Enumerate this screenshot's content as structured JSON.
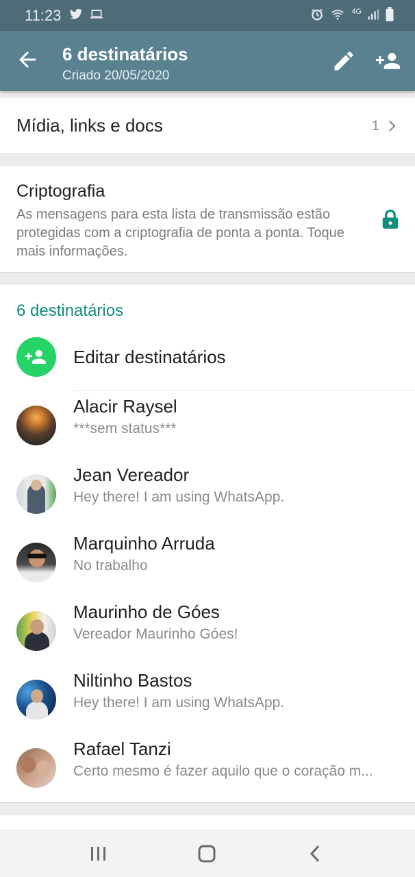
{
  "status_bar": {
    "time": "11:23",
    "network": "4G"
  },
  "header": {
    "title": "6 destinatários",
    "subtitle": "Criado 20/05/2020"
  },
  "media": {
    "label": "Mídia, links e docs",
    "count": "1"
  },
  "encryption": {
    "title": "Criptografia",
    "text": "As mensagens para esta lista de transmissão estão protegidas com a criptografia de ponta a ponta. Toque mais informações."
  },
  "recipients": {
    "section_title": "6 destinatários",
    "edit_label": "Editar destinatários",
    "contacts": [
      {
        "name": "Alacir Raysel",
        "status": "***sem status***"
      },
      {
        "name": "Jean Vereador",
        "status": "Hey there! I am using WhatsApp."
      },
      {
        "name": "Marquinho Arruda",
        "status": "No trabalho"
      },
      {
        "name": "Maurinho de Góes",
        "status": "Vereador Maurinho Góes!"
      },
      {
        "name": "Niltinho Bastos",
        "status": "Hey there! I am using WhatsApp."
      },
      {
        "name": "Rafael Tanzi",
        "status": "Certo mesmo é fazer aquilo que o coração m..."
      }
    ]
  },
  "colors": {
    "app_bar": "#5a8190",
    "status_bar": "#4e6b78",
    "accent_teal": "#128c7e",
    "accent_green": "#25d366"
  },
  "icons": [
    "twitter-icon",
    "laptop-icon",
    "alarm-icon",
    "wifi-icon",
    "signal-icon",
    "battery-icon",
    "back-arrow-icon",
    "pencil-icon",
    "add-person-icon",
    "chevron-right-icon",
    "lock-icon",
    "recents-icon",
    "home-icon",
    "back-icon"
  ]
}
